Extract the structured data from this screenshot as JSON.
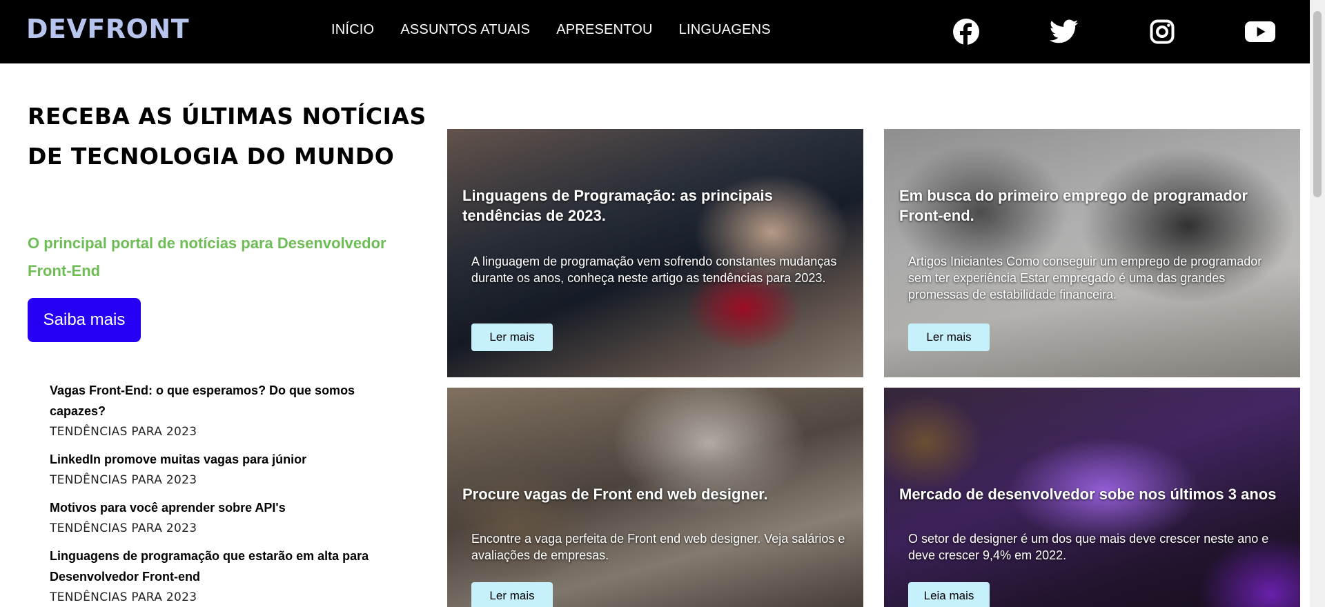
{
  "header": {
    "logo": "DEVFRONT",
    "nav": [
      "INÍCIO",
      "ASSUNTOS ATUAIS",
      "APRESENTOU",
      "LINGUAGENS"
    ],
    "social_icons": [
      "facebook-icon",
      "twitter-icon",
      "instagram-icon",
      "youtube-icon"
    ]
  },
  "hero": {
    "title": "RECEBA AS ÚLTIMAS NOTÍCIAS DE TECNOLOGIA DO MUNDO",
    "subtitle": "O principal portal de notícias para Desenvolvedor Front-End",
    "cta_label": "Saiba mais"
  },
  "news": [
    {
      "title": "Vagas Front-End: o que esperamos? Do que somos capazes?",
      "tag": "TENDÊNCIAS PARA 2023"
    },
    {
      "title": "LinkedIn promove muitas vagas para júnior",
      "tag": "TENDÊNCIAS PARA 2023"
    },
    {
      "title": "Motivos para você aprender sobre API's",
      "tag": "TENDÊNCIAS PARA 2023"
    },
    {
      "title": "Linguagens de programação que estarão em alta para Desenvolvedor Front-end",
      "tag": "TENDÊNCIAS PARA 2023"
    }
  ],
  "cards": [
    {
      "title": "Linguagens de Programação: as principais tendências de 2023.",
      "text": "A linguagem de programação vem sofrendo constantes mudanças durante os anos, conheça neste artigo as tendências para 2023.",
      "button": "Ler mais"
    },
    {
      "title": "Em busca do primeiro emprego de programador Front-end.",
      "text": "Artigos Iniciantes Como conseguir um emprego de programador sem ter experiência Estar empregado é uma das grandes promessas de estabilidade financeira.",
      "button": "Ler mais"
    },
    {
      "title": "Procure vagas de Front end web designer.",
      "text": "Encontre a vaga perfeita de Front end web designer. Veja salários e avaliações de empresas.",
      "button": "Ler mais"
    },
    {
      "title": "Mercado de desenvolvedor sobe nos últimos 3 anos",
      "text": "O setor de designer é um dos que mais deve crescer neste ano e deve crescer 9,4% em 2022.",
      "button": "Leia mais"
    }
  ],
  "colors": {
    "header_bg": "#000000",
    "logo": "#b7c4ee",
    "subtitle": "#6dbd55",
    "cta": "#2500f3",
    "card_button": "#c6f0fb"
  }
}
